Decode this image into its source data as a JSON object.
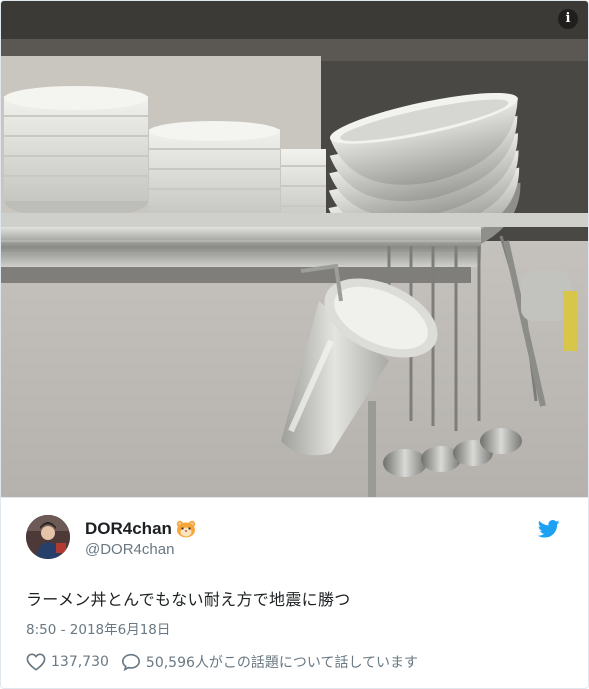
{
  "photo": {
    "description_icon": "info-icon",
    "info_label": "i"
  },
  "tweet": {
    "display_name": "DOR4chan",
    "emoji_icon": "hamster-face-icon",
    "handle": "@DOR4chan",
    "brand_icon": "twitter-bird-icon",
    "brand_color": "#1da1f2",
    "text": "ラーメン丼とんでもない耐え方で地震に勝つ",
    "timestamp": "8:50 - 2018年6月18日",
    "likes": "137,730",
    "like_icon": "heart-icon",
    "replies_text": "50,596人がこの話題について話しています",
    "reply_icon": "speech-bubble-icon"
  }
}
